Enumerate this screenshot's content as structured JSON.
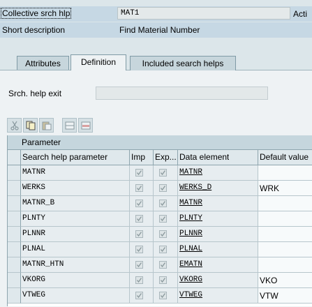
{
  "header": {
    "rows": [
      {
        "label": "Collective srch hlp",
        "value": "MAT1",
        "right": "Acti"
      },
      {
        "label": "Short description",
        "value": "Find Material Number"
      }
    ]
  },
  "tabs": [
    {
      "label": "Attributes",
      "active": false
    },
    {
      "label": "Definition",
      "active": true
    },
    {
      "label": "Included search helps",
      "active": false
    }
  ],
  "exit": {
    "label": "Srch. help exit",
    "value": ""
  },
  "toolbar": [
    {
      "icon": "cut-icon"
    },
    {
      "icon": "copy-icon"
    },
    {
      "icon": "paste-icon"
    },
    {
      "icon": "insert-row-icon"
    },
    {
      "icon": "delete-row-icon"
    }
  ],
  "table": {
    "group_header": "Parameter",
    "columns": [
      "Search help parameter",
      "Imp",
      "Exp...",
      "Data element",
      "Default value"
    ],
    "rows": [
      {
        "param": "MATNR",
        "imp": true,
        "exp": true,
        "data_element": "MATNR",
        "default": ""
      },
      {
        "param": "WERKS",
        "imp": true,
        "exp": true,
        "data_element": "WERKS_D",
        "default": "WRK"
      },
      {
        "param": "MATNR_B",
        "imp": true,
        "exp": true,
        "data_element": "MATNR",
        "default": ""
      },
      {
        "param": "PLNTY",
        "imp": true,
        "exp": true,
        "data_element": "PLNTY",
        "default": ""
      },
      {
        "param": "PLNNR",
        "imp": true,
        "exp": true,
        "data_element": "PLNNR",
        "default": ""
      },
      {
        "param": "PLNAL",
        "imp": true,
        "exp": true,
        "data_element": "PLNAL",
        "default": ""
      },
      {
        "param": "MATNR_HTN",
        "imp": true,
        "exp": true,
        "data_element": "EMATN",
        "default": ""
      },
      {
        "param": "VKORG",
        "imp": true,
        "exp": true,
        "data_element": "VKORG",
        "default": "VKO"
      },
      {
        "param": "VTWEG",
        "imp": true,
        "exp": true,
        "data_element": "VTWEG",
        "default": "VTW"
      }
    ]
  }
}
